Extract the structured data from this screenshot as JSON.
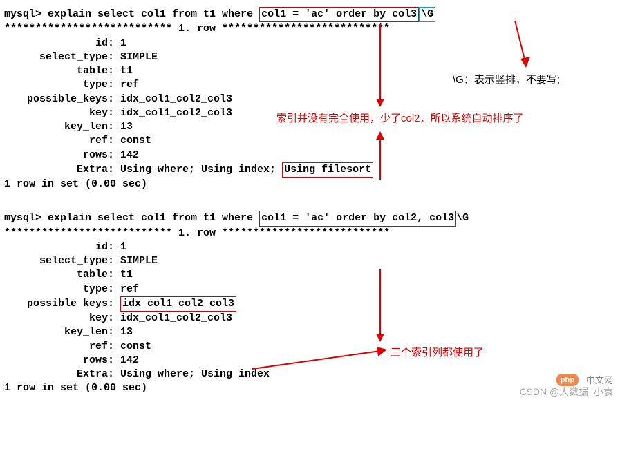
{
  "q1": {
    "prompt": "mysql> ",
    "sql_pre": "explain select col1 from t1 where ",
    "sql_boxed": "col1 = 'ac' order by col3",
    "sql_gtail": "\\G",
    "row_header": "*************************** 1. row ***************************",
    "rows": {
      "id": "1",
      "select_type": "SIMPLE",
      "table": "t1",
      "type": "ref",
      "possible_keys": "idx_col1_col2_col3",
      "key": "idx_col1_col2_col3",
      "key_len": "13",
      "ref": "const",
      "rows_n": "142",
      "extra_pre": "Using where; Using index; ",
      "extra_boxed": "Using filesort"
    },
    "footer": "1 row in set (0.00 sec)"
  },
  "q2": {
    "prompt": "mysql> ",
    "sql_pre": "explain select col1 from t1 where ",
    "sql_boxed": "col1 = 'ac' order by col2, col3",
    "sql_gtail": "\\G",
    "row_header": "*************************** 1. row ***************************",
    "rows": {
      "id": "1",
      "select_type": "SIMPLE",
      "table": "t1",
      "type": "ref",
      "possible_keys_boxed": "idx_col1_col2_col3",
      "key": "idx_col1_col2_col3",
      "key_len": "13",
      "ref": "const",
      "rows_n": "142",
      "extra": "Using where; Using index"
    },
    "footer": "1 row in set (0.00 sec)"
  },
  "annotations": {
    "gnote": "\\G：表示竖排，不要写;",
    "note1": "索引并没有完全使用，少了col2，所以系统自动排序了",
    "note2": "三个索引列都使用了"
  },
  "watermark": {
    "csdn": "CSDN @大数据_小袁",
    "php_badge": "php",
    "php_text": "中文网"
  }
}
